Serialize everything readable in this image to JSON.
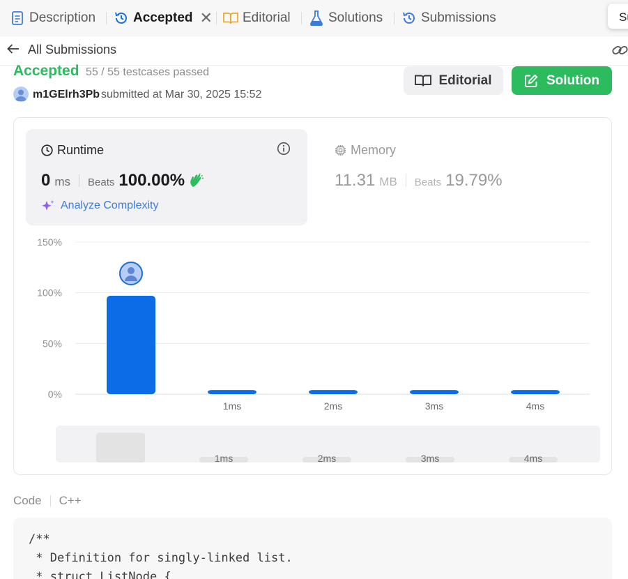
{
  "tabs": [
    {
      "label": "Description",
      "icon": "description-icon"
    },
    {
      "label": "Accepted",
      "icon": "history-icon",
      "active": true
    },
    {
      "label": "Editorial",
      "icon": "book-icon"
    },
    {
      "label": "Solutions",
      "icon": "flask-icon"
    },
    {
      "label": "Submissions",
      "icon": "history-icon"
    }
  ],
  "corner_popup": "Su",
  "subheader": {
    "back_label": "All Submissions"
  },
  "submission": {
    "status": "Accepted",
    "testcases": "55 / 55 testcases passed",
    "username": "m1GElrh3Pb",
    "submitted_prefix": "submitted at",
    "submitted_at": "Mar 30, 2025 15:52"
  },
  "buttons": {
    "editorial": "Editorial",
    "solution": "Solution"
  },
  "runtime": {
    "title": "Runtime",
    "value": "0",
    "unit": "ms",
    "beats_label": "Beats",
    "beats_value": "100.00%",
    "analyze_label": "Analyze Complexity"
  },
  "memory": {
    "title": "Memory",
    "value": "11.31",
    "unit": "MB",
    "beats_label": "Beats",
    "beats_value": "19.79%"
  },
  "chart_data": {
    "type": "bar",
    "categories": [
      "",
      "1ms",
      "2ms",
      "3ms",
      "4ms"
    ],
    "values": [
      97,
      4,
      4,
      4,
      4
    ],
    "yticks": [
      "150%",
      "100%",
      "50%",
      "0%"
    ],
    "ylim": [
      0,
      150
    ],
    "grid": true,
    "highlight_index": 0,
    "bar_color": "#0a6ce6",
    "minimap": {
      "categories": [
        "",
        "1ms",
        "2ms",
        "3ms",
        "4ms"
      ],
      "values": [
        97,
        4,
        4,
        4,
        4
      ]
    }
  },
  "code": {
    "label": "Code",
    "language": "C++",
    "lines": [
      "/**",
      " * Definition for singly-linked list.",
      " * struct ListNode {"
    ]
  },
  "colors": {
    "accent_green": "#2cbb5d",
    "bar_blue": "#0a6ce6",
    "link_blue": "#3d7bd9"
  }
}
